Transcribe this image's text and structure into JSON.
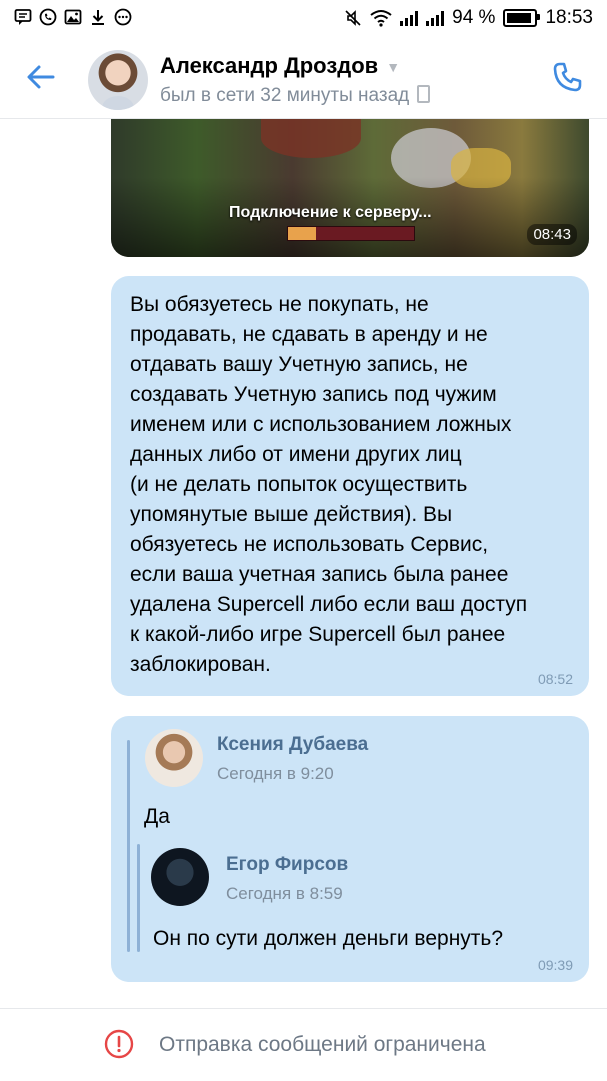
{
  "status_bar": {
    "battery_percent": "94 %",
    "time": "18:53",
    "icons": [
      "message-icon",
      "whatsapp-icon",
      "gallery-icon",
      "download-icon",
      "more-icon",
      "mute-icon",
      "wifi-icon",
      "signal-icon",
      "signal-icon",
      "battery-icon"
    ]
  },
  "header": {
    "name": "Александр Дроздов",
    "last_seen": "был в сети 32 минуты назад",
    "icons": [
      "back-arrow-icon",
      "chevron-down-icon",
      "mobile-icon",
      "phone-call-icon"
    ]
  },
  "messages": {
    "image_message": {
      "caption": "Подключение к серверу...",
      "progress": 0.22,
      "time": "08:43"
    },
    "text_message": {
      "lines": [
        "Вы обязуетесь не покупать, не",
        "продавать, не сдавать в аренду и не",
        "отдавать вашу Учетную запись, не",
        "создавать Учетную запись под чужим",
        "именем или с использованием ложных",
        "данных либо от имени других лиц",
        "(и не делать попыток осуществить",
        "упомянутые выше действия). Вы",
        "обязуетесь не использовать Сервис,",
        "если ваша учетная запись была ранее",
        "удалена Supercell либо если ваш доступ",
        "к какой-либо игре Supercell был ранее",
        "заблокирован."
      ],
      "time": "08:52"
    },
    "forwarded_message": {
      "outer_author": "Ксения Дубаева",
      "outer_date": "Сегодня в 9:20",
      "outer_text": "Да",
      "inner_author": "Егор Фирсов",
      "inner_date": "Сегодня в 8:59",
      "inner_text": "Он по сути должен деньги вернуть?",
      "time": "09:39"
    }
  },
  "footer": {
    "notice": "Отправка сообщений ограничена",
    "icon": "warning-circle-icon"
  },
  "colors": {
    "accent": "#3f8ae0",
    "bubble": "#cce4f7",
    "warning": "#e64646",
    "quote_name": "#4b6e91"
  }
}
